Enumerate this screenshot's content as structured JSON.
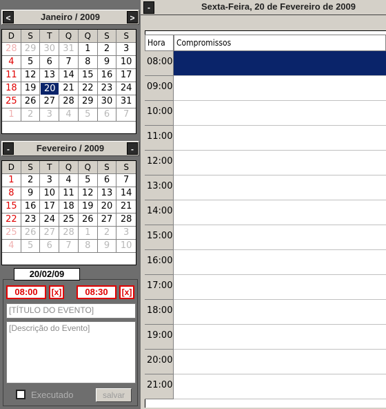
{
  "calendar1": {
    "month_title": "Janeiro / 2009",
    "prev_glyph": "<",
    "next_glyph": ">",
    "weekday_headers": [
      "D",
      "S",
      "T",
      "Q",
      "Q",
      "S",
      "S"
    ],
    "weeks": [
      [
        "28",
        "29",
        "30",
        "31",
        "1",
        "2",
        "3"
      ],
      [
        "4",
        "5",
        "6",
        "7",
        "8",
        "9",
        "10"
      ],
      [
        "11",
        "12",
        "13",
        "14",
        "15",
        "16",
        "17"
      ],
      [
        "18",
        "19",
        "20",
        "21",
        "22",
        "23",
        "24"
      ],
      [
        "25",
        "26",
        "27",
        "28",
        "29",
        "30",
        "31"
      ],
      [
        "1",
        "2",
        "3",
        "4",
        "5",
        "6",
        "7"
      ]
    ],
    "selected_day": "20"
  },
  "calendar2": {
    "month_title": "Fevereiro / 2009",
    "prev_glyph": "-",
    "next_glyph": "-",
    "weekday_headers": [
      "D",
      "S",
      "T",
      "Q",
      "Q",
      "S",
      "S"
    ],
    "weeks": [
      [
        "1",
        "2",
        "3",
        "4",
        "5",
        "6",
        "7"
      ],
      [
        "8",
        "9",
        "10",
        "11",
        "12",
        "13",
        "14"
      ],
      [
        "15",
        "16",
        "17",
        "18",
        "19",
        "20",
        "21"
      ],
      [
        "22",
        "23",
        "24",
        "25",
        "26",
        "27",
        "28"
      ],
      [
        "25",
        "26",
        "27",
        "28",
        "1",
        "2",
        "3"
      ],
      [
        "4",
        "5",
        "6",
        "7",
        "8",
        "9",
        "10"
      ]
    ]
  },
  "event": {
    "date_tab": "20/02/09",
    "start_time": "08:00",
    "end_time": "08:30",
    "clear_label": "[x]",
    "title_placeholder": "[TÍTULO DO EVENTO]",
    "description_placeholder": "[Descrição do Evento]",
    "executed_label": "Executado",
    "save_label": "salvar"
  },
  "schedule": {
    "collapse_glyph": "-",
    "day_title": "Sexta-Feira, 20 de Fevereiro de 2009",
    "hour_header": "Hora",
    "appointments_header": "Compromissos",
    "hours": [
      "08:00",
      "09:00",
      "10:00",
      "11:00",
      "12:00",
      "13:00",
      "14:00",
      "15:00",
      "16:00",
      "17:00",
      "18:00",
      "19:00",
      "20:00",
      "21:00"
    ],
    "active_hour": "08:00"
  },
  "colors": {
    "selection": "#0a246a",
    "weekend_red": "#e00000",
    "panel_dark": "#6e6e6e",
    "panel_light": "#d4d0c8"
  }
}
